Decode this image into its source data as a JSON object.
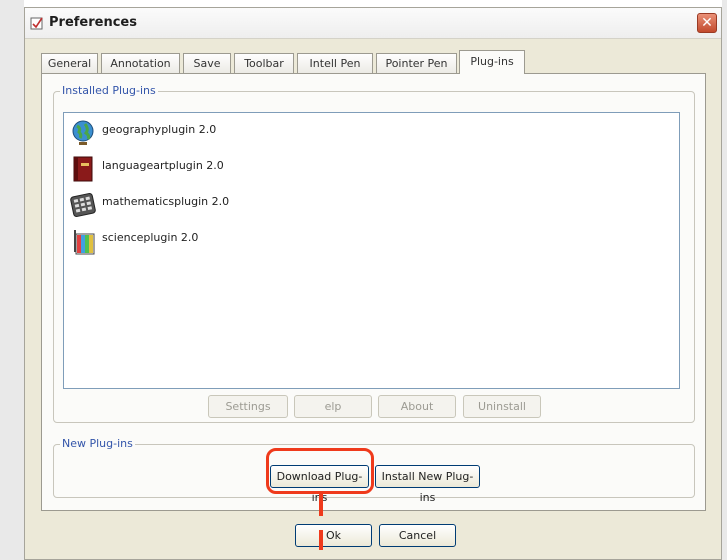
{
  "window": {
    "title": "Preferences",
    "close_glyph": "✕"
  },
  "tabs": [
    {
      "label": "General"
    },
    {
      "label": "Annotation"
    },
    {
      "label": "Save"
    },
    {
      "label": "Toolbar"
    },
    {
      "label": "Intell Pen"
    },
    {
      "label": "Pointer Pen"
    },
    {
      "label": "Plug-ins",
      "active": true
    }
  ],
  "installed": {
    "title": "Installed Plug-ins",
    "plugins": [
      {
        "label": "geographyplugin 2.0",
        "icon": "globe-icon"
      },
      {
        "label": "languageartplugin 2.0",
        "icon": "book-icon"
      },
      {
        "label": "mathematicsplugin 2.0",
        "icon": "calculator-icon"
      },
      {
        "label": "scienceplugin 2.0",
        "icon": "beaker-icon"
      }
    ],
    "buttons": {
      "settings": "Settings",
      "help": "elp",
      "about": "About",
      "uninstall": "Uninstall"
    }
  },
  "new_plugins": {
    "title": "New Plug-ins",
    "download": "Download Plug-ins",
    "install": "Install New Plug-ins"
  },
  "footer": {
    "ok": "Ok",
    "cancel": "Cancel"
  },
  "colors": {
    "highlight": "#ef3a1c",
    "group_title": "#3355aa"
  }
}
